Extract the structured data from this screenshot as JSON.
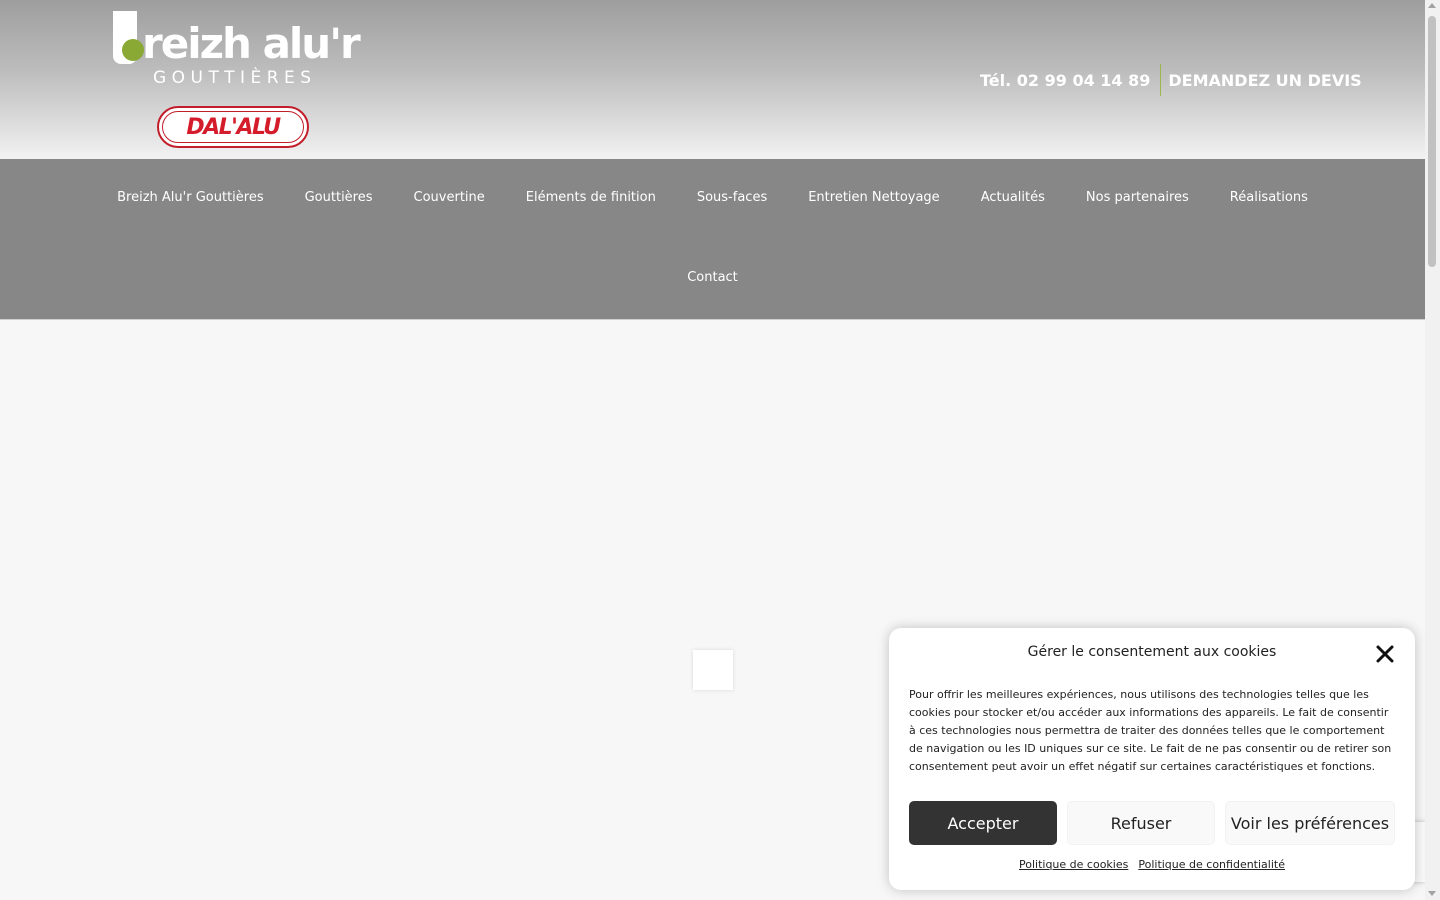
{
  "header": {
    "logo": {
      "brand": "reizh alu'r",
      "subtitle": "GOUTTIÈRES"
    },
    "partner_logo": {
      "text": "DAL'ALU"
    },
    "phone": "Tél. 02 99 04 14 89",
    "quote_link": "DEMANDEZ UN DEVIS"
  },
  "nav": {
    "items": [
      {
        "label": "Breizh Alu'r Gouttières"
      },
      {
        "label": "Gouttières"
      },
      {
        "label": "Couvertine"
      },
      {
        "label": "Eléments de finition"
      },
      {
        "label": "Sous-faces"
      },
      {
        "label": "Entretien Nettoyage"
      },
      {
        "label": "Actualités"
      },
      {
        "label": "Nos partenaires"
      },
      {
        "label": "Réalisations"
      },
      {
        "label": "Contact"
      }
    ]
  },
  "cookie_dialog": {
    "title": "Gérer le consentement aux cookies",
    "text": "Pour offrir les meilleures expériences, nous utilisons des technologies telles que les cookies pour stocker et/ou accéder aux informations des appareils. Le fait de consentir à ces technologies nous permettra de traiter des données telles que le comportement de navigation ou les ID uniques sur ce site. Le fait de ne pas consentir ou de retirer son consentement peut avoir un effet négatif sur certaines caractéristiques et fonctions.",
    "accept_label": "Accepter",
    "refuse_label": "Refuser",
    "preferences_label": "Voir les préférences",
    "cookie_policy_link": "Politique de cookies",
    "privacy_policy_link": "Politique de confidentialité"
  },
  "colors": {
    "nav_bg": "#878787",
    "accent_green": "#8aa834",
    "partner_red": "#d51c2a",
    "accept_bg": "#333333"
  }
}
